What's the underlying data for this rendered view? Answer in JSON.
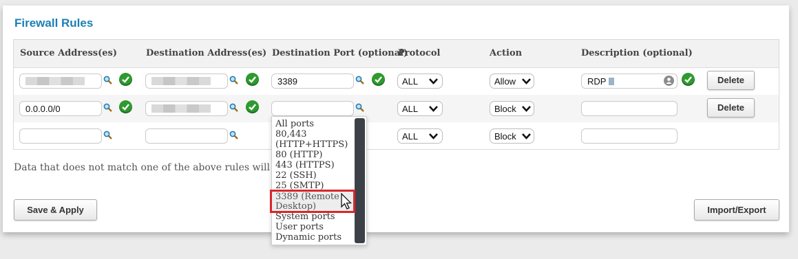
{
  "title": "Firewall Rules",
  "headers": {
    "source": "Source Address(es)",
    "destination": "Destination Address(es)",
    "port": "Destination Port (optional)",
    "protocol": "Protocol",
    "action": "Action",
    "description": "Description (optional)"
  },
  "rows": [
    {
      "source": "",
      "destination": "",
      "port": "3389",
      "protocol": "ALL",
      "action": "Allow",
      "description": "RDP",
      "delete_label": "Delete"
    },
    {
      "source": "0.0.0.0/0",
      "destination": "",
      "port": "",
      "protocol": "ALL",
      "action": "Block",
      "description": "",
      "delete_label": "Delete"
    },
    {
      "source": "",
      "destination": "",
      "port": "",
      "protocol": "ALL",
      "action": "Block",
      "description": ""
    }
  ],
  "note": "Data that does not match one of the above rules will b",
  "port_dropdown": {
    "options": [
      "All ports",
      "80,443",
      "(HTTP+HTTPS)",
      "80 (HTTP)",
      "443 (HTTPS)",
      "22 (SSH)",
      "25 (SMTP)",
      "3389 (Remote",
      "Desktop)",
      "System ports",
      "User ports",
      "Dynamic ports"
    ],
    "highlighted": "3389 (Remote Desktop)"
  },
  "buttons": {
    "save": "Save & Apply",
    "import_export": "Import/Export"
  }
}
